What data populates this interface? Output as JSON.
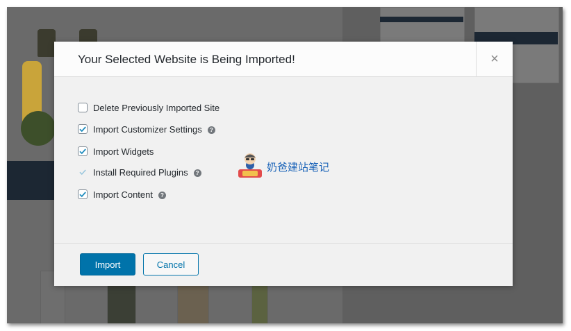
{
  "modal": {
    "title": "Your Selected Website is Being Imported!",
    "close_icon": "close-icon",
    "options": [
      {
        "label": "Delete Previously Imported Site",
        "checked": false,
        "help": false
      },
      {
        "label": "Import Customizer Settings",
        "checked": true,
        "help": true
      },
      {
        "label": "Import Widgets",
        "checked": true,
        "help": false
      },
      {
        "label": "Install Required Plugins",
        "checked": true,
        "disabled": true,
        "help": true
      },
      {
        "label": "Import Content",
        "checked": true,
        "help": true
      }
    ],
    "help_glyph": "?",
    "import_label": "Import",
    "cancel_label": "Cancel"
  },
  "watermark": {
    "text": "奶爸建站笔记"
  },
  "colors": {
    "primary": "#0073aa",
    "header_bg": "#fcfcfc",
    "body_bg": "#f1f1f1"
  }
}
